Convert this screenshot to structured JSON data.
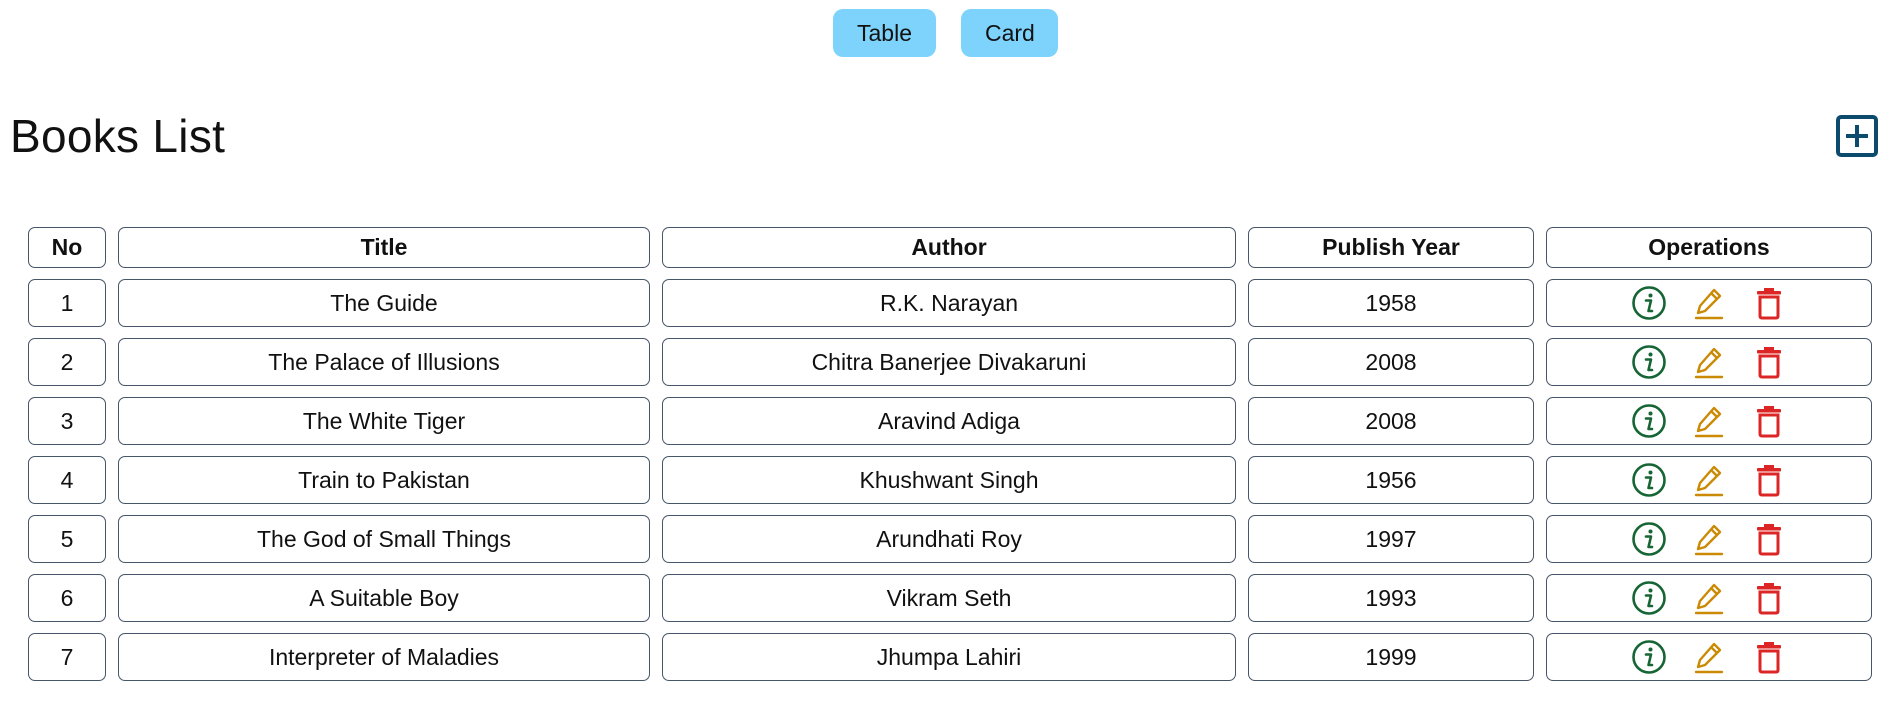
{
  "view_toggle": {
    "table_label": "Table",
    "card_label": "Card"
  },
  "header": {
    "title": "Books List",
    "add_icon": "plus-square-icon"
  },
  "table": {
    "columns": [
      "No",
      "Title",
      "Author",
      "Publish Year",
      "Operations"
    ],
    "rows": [
      {
        "no": "1",
        "title": "The Guide",
        "author": "R.K. Narayan",
        "year": "1958"
      },
      {
        "no": "2",
        "title": "The Palace of Illusions",
        "author": "Chitra Banerjee Divakaruni",
        "year": "2008"
      },
      {
        "no": "3",
        "title": "The White Tiger",
        "author": "Aravind Adiga",
        "year": "2008"
      },
      {
        "no": "4",
        "title": "Train to Pakistan",
        "author": "Khushwant Singh",
        "year": "1956"
      },
      {
        "no": "5",
        "title": "The God of Small Things",
        "author": "Arundhati Roy",
        "year": "1997"
      },
      {
        "no": "6",
        "title": "A Suitable Boy",
        "author": "Vikram Seth",
        "year": "1993"
      },
      {
        "no": "7",
        "title": "Interpreter of Maladies",
        "author": "Jhumpa Lahiri",
        "year": "1999"
      }
    ],
    "operation_icons": [
      "info-circle-icon",
      "edit-pencil-icon",
      "trash-icon"
    ]
  },
  "colors": {
    "toggle_button": "#7dd3fc",
    "add_icon": "#0c4a6e",
    "info_icon": "#166534",
    "edit_icon": "#ca8a04",
    "delete_icon": "#dc2626",
    "cell_border": "#475569"
  }
}
